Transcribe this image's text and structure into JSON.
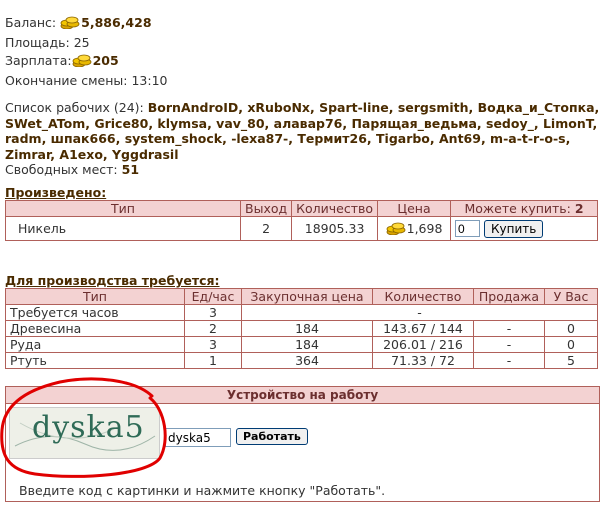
{
  "stats": {
    "balance_label": "Баланс:",
    "balance_value": "5,886,428",
    "area_label": "Площадь:",
    "area_value": "25",
    "salary_label": "Зарплата:",
    "salary_value": "205",
    "shift_end_label": "Окончание смены:",
    "shift_end_value": "13:10"
  },
  "workers": {
    "label": "Список рабочих (24):",
    "names": "BornAndroID, xRuboNx, Spart-line, sergsmith, Водка_и_Стопка, SWet_ATom, Grice80, klymsa, vav_80, алавар76, Парящая_ведьма, sedoy_, LimonT, radm, шпак666, system_shock, -lexa87-, Термит26, Tigarbo, Ant69, m-a-t-r-o-s, Zimrar, A1exo, Yggdrasil",
    "free_label": "Свободных мест:",
    "free_value": "51"
  },
  "produced": {
    "title": "Произведено:",
    "headers": {
      "type": "Тип",
      "output": "Выход",
      "quantity": "Количество",
      "price": "Цена",
      "can_buy_label": "Можете купить:",
      "can_buy_value": "2"
    },
    "row": {
      "type": "Никель",
      "output": "2",
      "quantity": "18905.33",
      "price": "1,698",
      "qty_input": "0",
      "buy_button": "Купить"
    }
  },
  "requirements": {
    "title": "Для производства требуется:",
    "headers": [
      "Тип",
      "Ед/час",
      "Закупочная цена",
      "Количество",
      "Продажа",
      "У Вас"
    ],
    "rows": [
      [
        "Требуется часов",
        "3",
        "",
        "-",
        "",
        ""
      ],
      [
        "Древесина",
        "2",
        "184",
        "143.67 / 144",
        "-",
        "0"
      ],
      [
        "Руда",
        "3",
        "184",
        "206.01 / 216",
        "-",
        "0"
      ],
      [
        "Ртуть",
        "1",
        "364",
        "71.33 / 72",
        "-",
        "5"
      ]
    ]
  },
  "job": {
    "title": "Устройство на работу",
    "captcha_text": "dyska5",
    "code_value": "dyska5",
    "work_button": "Работать",
    "hint": "Введите код с картинки и нажмите кнопку \"Работать\"."
  },
  "colors": {
    "header_bg": "#f3d2d2",
    "border": "#b0605a",
    "accent_text": "#4a2b00",
    "annotation_circle": "#e00000"
  }
}
